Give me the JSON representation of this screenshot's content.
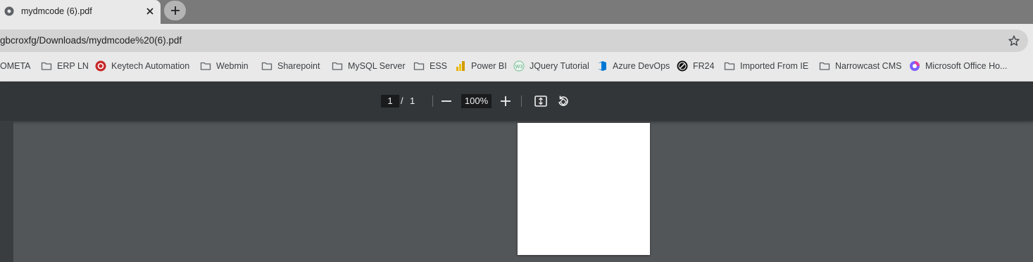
{
  "tab": {
    "title": "mydmcode (6).pdf",
    "favicon": "globe-icon"
  },
  "omnibox": {
    "url": "gbcroxfg/Downloads/mydmcode%20(6).pdf"
  },
  "bookmarks": [
    {
      "label": "OMETA",
      "icon": "none"
    },
    {
      "label": "ERP LN",
      "icon": "folder-icon"
    },
    {
      "label": "Keytech Automation",
      "icon": "keytech-logo-icon"
    },
    {
      "label": "Webmin",
      "icon": "folder-icon"
    },
    {
      "label": "Sharepoint",
      "icon": "folder-icon"
    },
    {
      "label": "MySQL Server",
      "icon": "folder-icon"
    },
    {
      "label": "ESS",
      "icon": "folder-icon"
    },
    {
      "label": "Power BI",
      "icon": "power-bi-icon"
    },
    {
      "label": "JQuery Tutorial",
      "icon": "jquery-icon"
    },
    {
      "label": "Azure DevOps",
      "icon": "azure-devops-icon"
    },
    {
      "label": "FR24",
      "icon": "fr24-icon"
    },
    {
      "label": "Imported From IE",
      "icon": "folder-icon"
    },
    {
      "label": "Narrowcast CMS",
      "icon": "folder-icon"
    },
    {
      "label": "Microsoft Office Ho...",
      "icon": "office-icon"
    }
  ],
  "pdf_toolbar": {
    "current_page": "1",
    "separator": "/",
    "total_pages": "1",
    "zoom": "100%"
  },
  "colors": {
    "viewer_background": "#525659",
    "toolbar_background": "#323639",
    "browser_chrome": "#e9e9e9"
  }
}
